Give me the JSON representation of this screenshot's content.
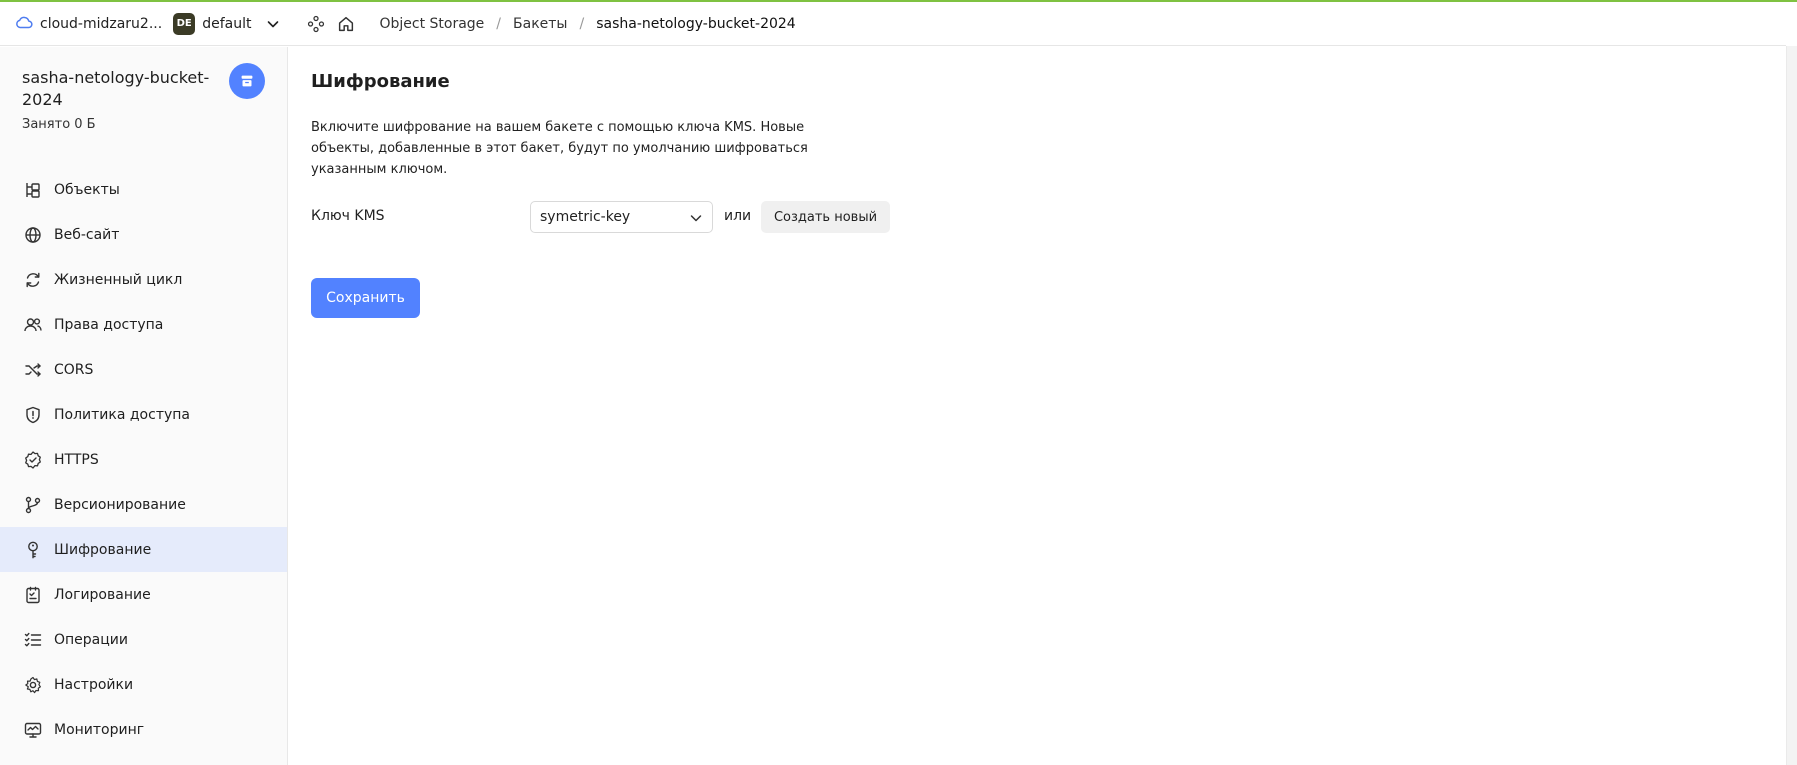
{
  "header": {
    "cloud_name": "cloud-midzaru2...",
    "folder_badge": "DE",
    "folder_name": "default",
    "breadcrumbs": [
      "Object Storage",
      "Бакеты",
      "sasha-netology-bucket-2024"
    ],
    "separator": "/"
  },
  "sidebar": {
    "bucket_name": "sasha-netology-bucket-2024",
    "used": "Занято 0 Б",
    "items": [
      {
        "label": "Объекты",
        "icon": "objects-icon"
      },
      {
        "label": "Веб-сайт",
        "icon": "globe-icon"
      },
      {
        "label": "Жизненный цикл",
        "icon": "lifecycle-icon"
      },
      {
        "label": "Права доступа",
        "icon": "users-icon"
      },
      {
        "label": "CORS",
        "icon": "shuffle-icon"
      },
      {
        "label": "Политика доступа",
        "icon": "shield-icon"
      },
      {
        "label": "HTTPS",
        "icon": "badge-check-icon"
      },
      {
        "label": "Версионирование",
        "icon": "branch-icon"
      },
      {
        "label": "Шифрование",
        "icon": "key-icon",
        "active": true
      },
      {
        "label": "Логирование",
        "icon": "log-icon"
      },
      {
        "label": "Операции",
        "icon": "list-check-icon"
      },
      {
        "label": "Настройки",
        "icon": "gear-icon"
      },
      {
        "label": "Мониторинг",
        "icon": "monitor-icon"
      }
    ]
  },
  "main": {
    "title": "Шифрование",
    "description": "Включите шифрование на вашем бакете с помощью ключа KMS. Новые объекты, добавленные в этот бакет, будут по умолчанию шифроваться указанным ключом.",
    "kms_label": "Ключ KMS",
    "kms_value": "symetric-key",
    "or_text": "или",
    "create_button": "Создать новый",
    "save_button": "Сохранить"
  },
  "colors": {
    "accent": "#5282ff",
    "active_bg": "#e5ebfb",
    "top_line": "#7fc241"
  }
}
